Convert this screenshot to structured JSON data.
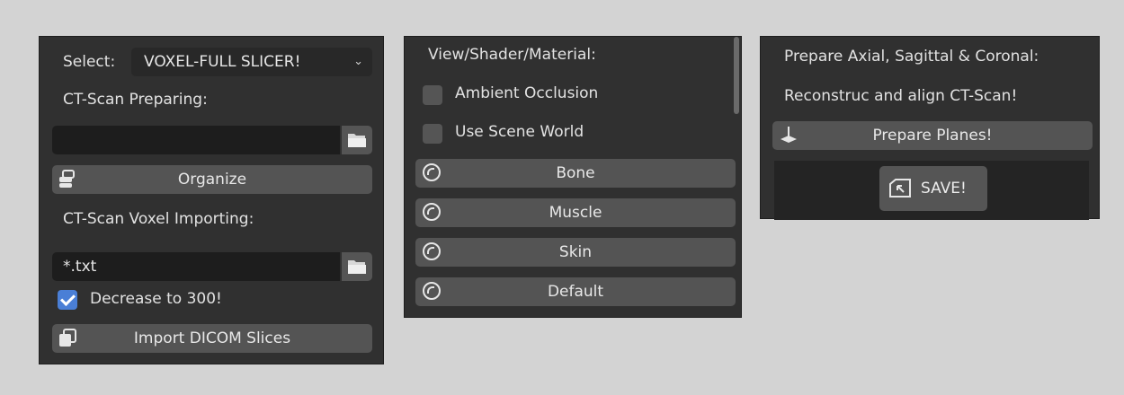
{
  "panel1": {
    "select_label": "Select:",
    "select_value": "VOXEL-FULL SLICER!",
    "preparing_label": "CT-Scan Preparing:",
    "preparing_path": "",
    "organize_label": "Organize",
    "importing_label": "CT-Scan Voxel Importing:",
    "import_path": "*.txt",
    "decrease_label": "Decrease to 300!",
    "decrease_checked": true,
    "import_button_label": "Import DICOM Slices"
  },
  "panel2": {
    "header": "View/Shader/Material:",
    "ambient_occlusion_label": "Ambient Occlusion",
    "ambient_occlusion_checked": false,
    "use_scene_world_label": "Use Scene World",
    "use_scene_world_checked": false,
    "materials": [
      "Bone",
      "Muscle",
      "Skin",
      "Default"
    ],
    "material_icon": "sphere-icon"
  },
  "panel3": {
    "line1": "Prepare Axial, Sagittal & Coronal:",
    "line2": "Reconstruc and align CT-Scan!",
    "prepare_button_label": "Prepare Planes!",
    "save_button_label": "SAVE!"
  },
  "colors": {
    "background": "#d3d3d3",
    "panel": "#303030",
    "button": "#545454",
    "field": "#1d1d1d",
    "checkbox_on": "#4a7fd6"
  }
}
